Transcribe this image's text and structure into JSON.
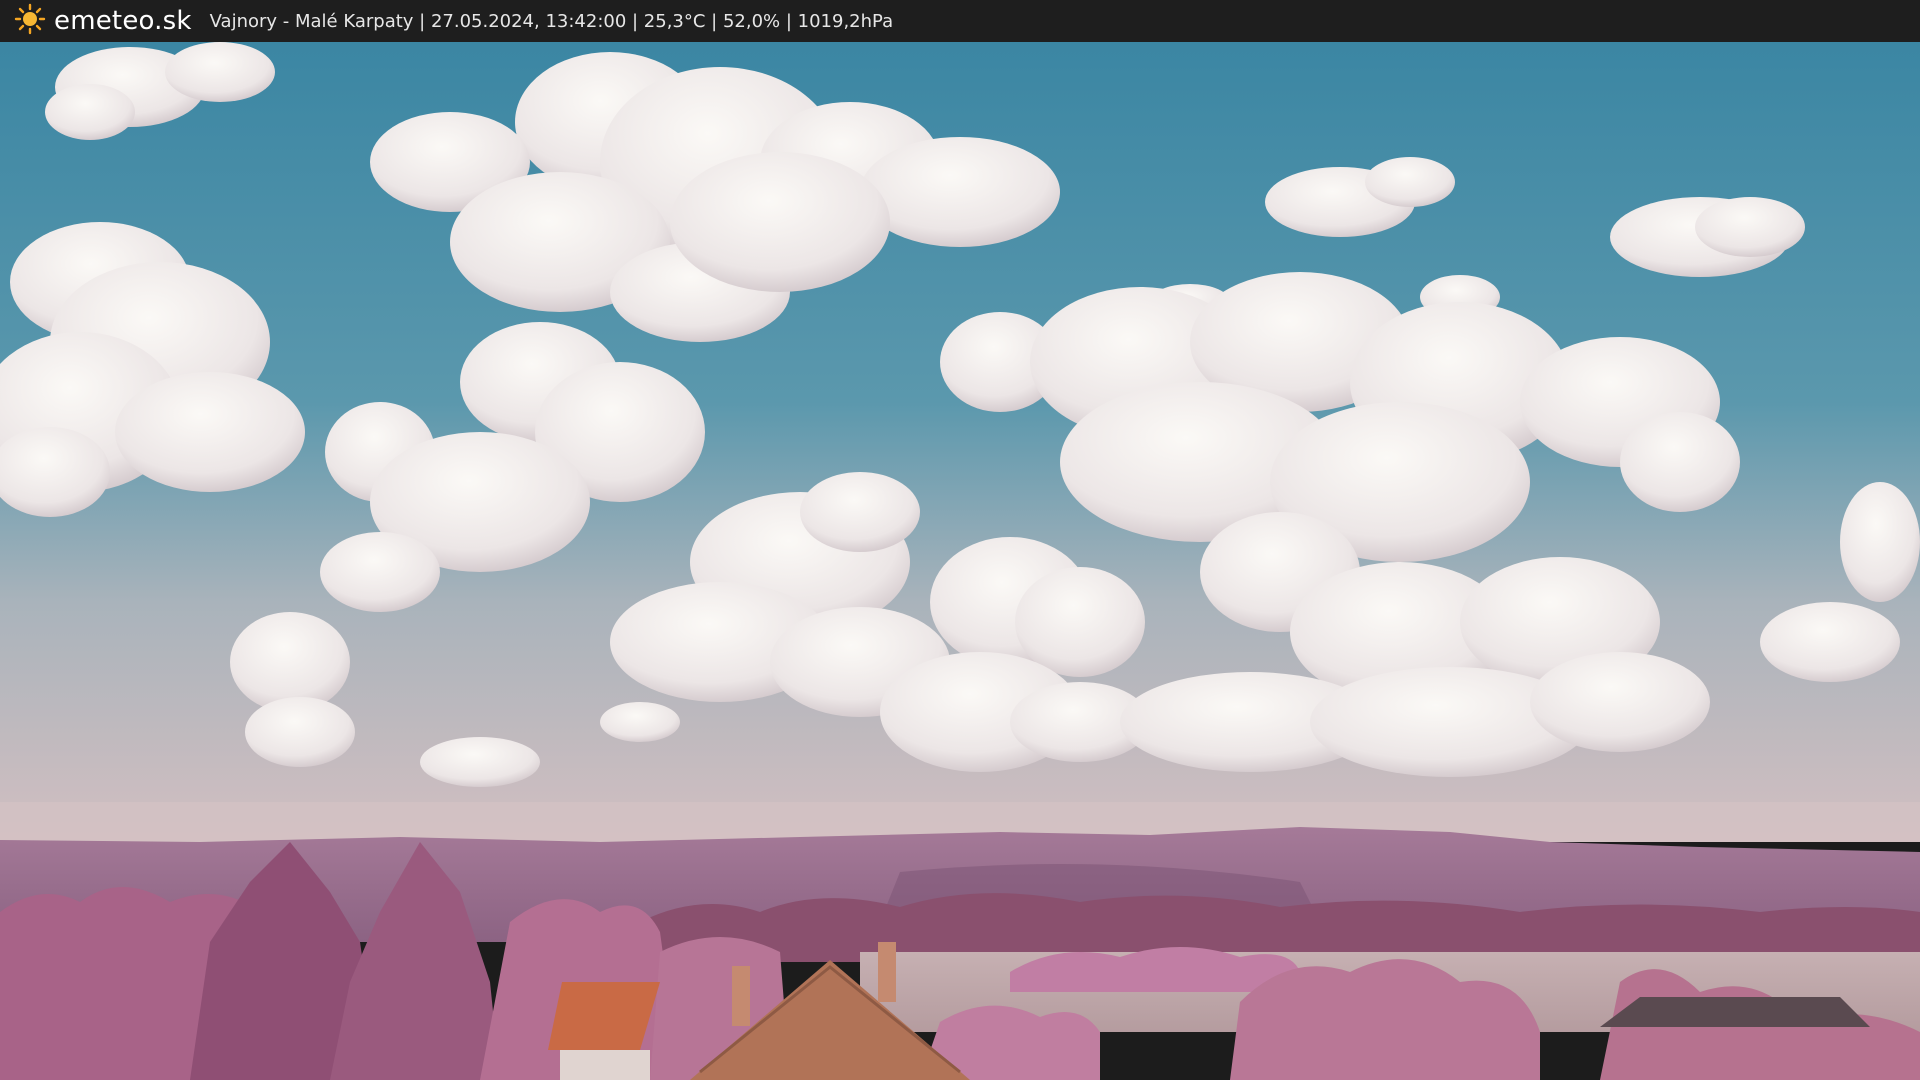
{
  "header": {
    "brand": "emeteo.sk",
    "logo_icon": "sun-icon",
    "caption": "Vajnory - Malé Karpaty | 27.05.2024, 13:42:00 | 25,3°C | 52,0% | 1019,2hPa"
  },
  "colors": {
    "bar": "#1e1e1e",
    "sky_top": "#3f8aa6",
    "sky_haze": "#c9b8bc",
    "cloud": "#f1eeee",
    "hills": "#9a6f8e",
    "trees": "#b0708f",
    "roof": "#c96a45",
    "sun": "#f5a623"
  }
}
